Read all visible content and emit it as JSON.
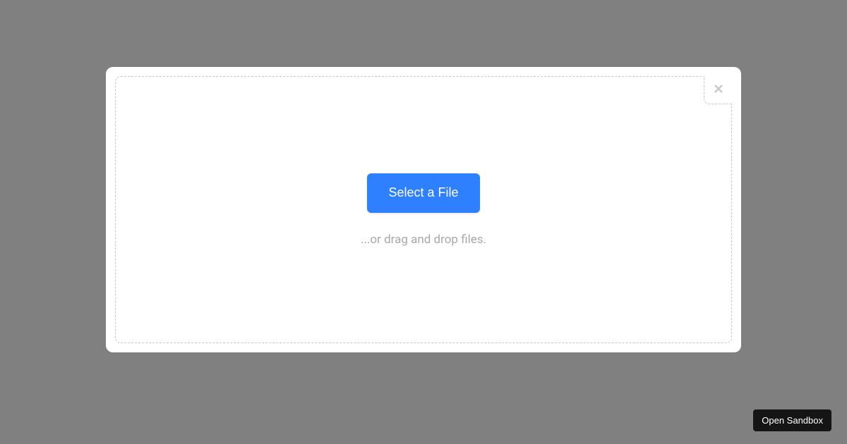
{
  "modal": {
    "select_button_label": "Select a File",
    "drag_text": "...or drag and drop files."
  },
  "footer": {
    "open_sandbox_label": "Open Sandbox"
  }
}
